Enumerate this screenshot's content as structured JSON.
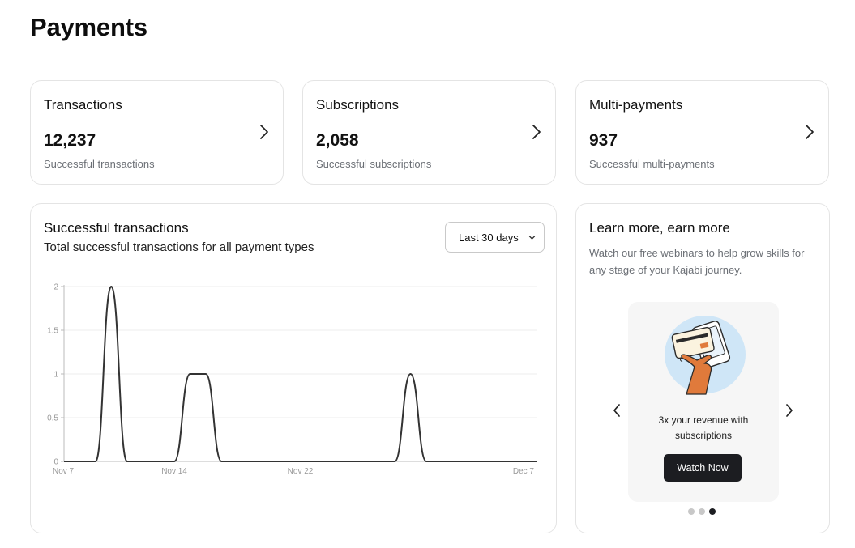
{
  "page": {
    "title": "Payments"
  },
  "stats": [
    {
      "label": "Transactions",
      "value": "12,237",
      "sub": "Successful transactions"
    },
    {
      "label": "Subscriptions",
      "value": "2,058",
      "sub": "Successful subscriptions"
    },
    {
      "label": "Multi-payments",
      "value": "937",
      "sub": "Successful multi-payments"
    }
  ],
  "chart_panel": {
    "title": "Successful transactions",
    "subtitle": "Total successful transactions for all payment types",
    "range_selected": "Last 30 days"
  },
  "chart_data": {
    "type": "line",
    "title": "Successful transactions",
    "subtitle": "Total successful transactions for all payment types",
    "xlabel": "",
    "ylabel": "",
    "x_ticks": [
      "Nov 7",
      "Nov 14",
      "Nov 22",
      "Dec 7"
    ],
    "x_tick_days": [
      0,
      7,
      15,
      30
    ],
    "y_ticks": [
      "0",
      "0.5",
      "1",
      "1.5",
      "2"
    ],
    "y_tick_values": [
      0,
      0.5,
      1,
      1.5,
      2
    ],
    "ylim": [
      0,
      2
    ],
    "xlim_days": [
      0,
      30
    ],
    "grid": true,
    "line_color": "#333333",
    "series": [
      {
        "x_days": [
          0,
          1,
          2,
          3,
          4,
          5,
          6,
          7,
          8,
          9,
          10,
          11,
          12,
          13,
          14,
          15,
          16,
          17,
          18,
          19,
          20,
          21,
          22,
          23,
          24,
          25,
          26,
          27,
          28,
          29,
          30
        ],
        "values": [
          0,
          0,
          0,
          2,
          0,
          0,
          0,
          0,
          1,
          1,
          0,
          0,
          0,
          0,
          0,
          0,
          0,
          0,
          0,
          0,
          0,
          0,
          1,
          0,
          0,
          0,
          0,
          0,
          0,
          0,
          0
        ]
      }
    ]
  },
  "promo": {
    "title": "Learn more, earn more",
    "text": "Watch our free webinars to help grow skills for any stage of your Kajabi journey.",
    "slide_caption": "3x your revenue with subscriptions",
    "button_label": "Watch Now",
    "dots_total": 3,
    "dots_active": 3
  },
  "icons": {
    "stat_chevron": "chevron-right-icon",
    "select_caret": "chevron-down-icon",
    "prev": "chevron-left-icon",
    "next": "chevron-right-icon",
    "illustration": "payment-cards-hand-illustration"
  },
  "colors": {
    "button_bg": "#1c1d21",
    "slide_bg": "#f6f6f6",
    "illustration_circle": "#cfe6f7",
    "hand": "#e07a3b"
  }
}
